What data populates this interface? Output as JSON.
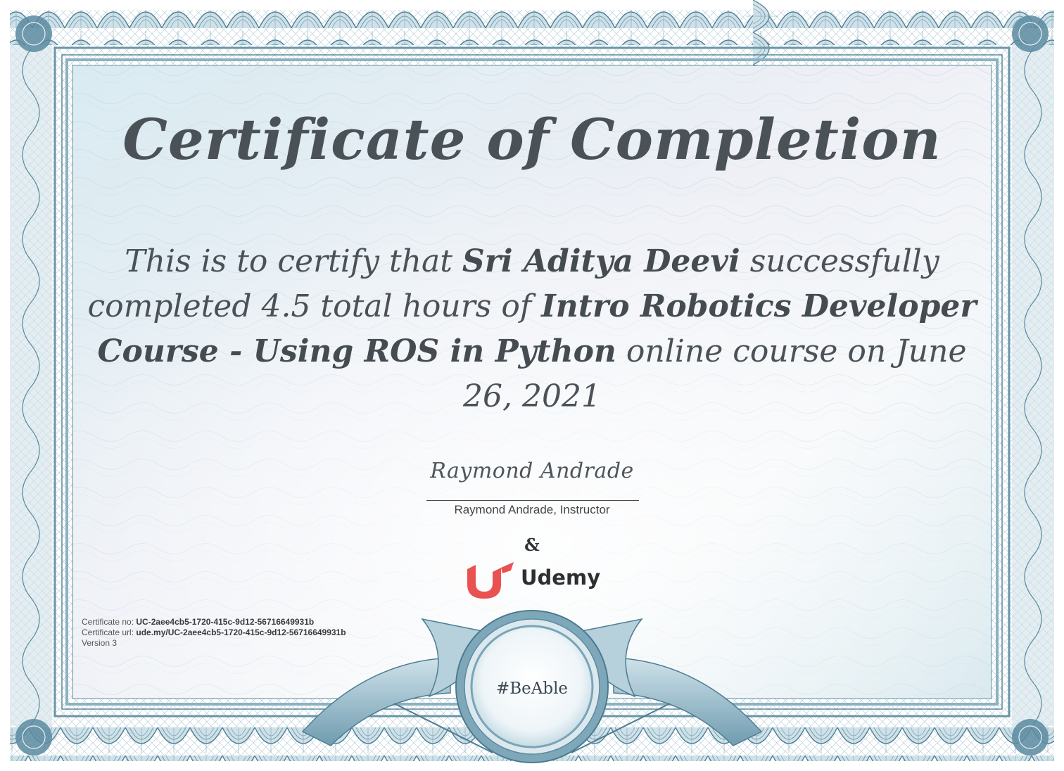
{
  "certificate": {
    "title": "Certificate of Completion",
    "statement": {
      "prefix": "This is to certify that",
      "recipient": "Sri Aditya Deevi",
      "middle": "successfully completed 4.5 total hours of",
      "course_name": "Intro Robotics Developer Course - Using ROS in Python",
      "suffix": "online course on June 26, 2021"
    },
    "signature": {
      "script": "Raymond Andrade",
      "caption": "Raymond Andrade, Instructor"
    },
    "ampersand": "&",
    "brand": {
      "name": "Udemy",
      "color": "#ea5252"
    },
    "meta": {
      "number_label": "Certificate no:",
      "number": "UC-2aee4cb5-1720-415c-9d12-56716649931b",
      "url_label": "Certificate url:",
      "url": "ude.my/UC-2aee4cb5-1720-415c-9d12-56716649931b",
      "version": "Version 3"
    },
    "seal": {
      "text": "#BeAble"
    },
    "colors": {
      "border": "#5f8ea3",
      "text": "#4b5257",
      "background": "#e9f1f4"
    }
  }
}
